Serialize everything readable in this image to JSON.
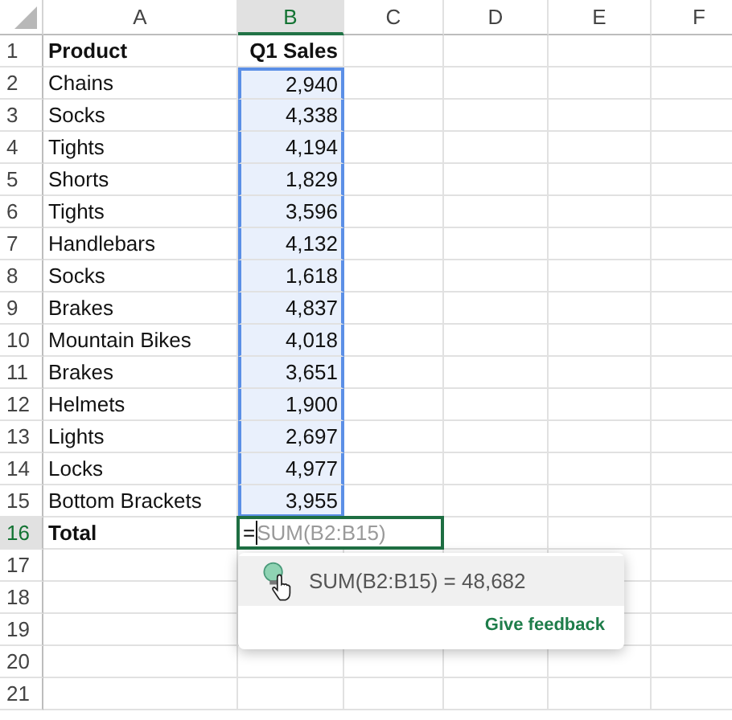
{
  "columns": [
    {
      "label": "A",
      "selected": false
    },
    {
      "label": "B",
      "selected": true
    },
    {
      "label": "C",
      "selected": false
    },
    {
      "label": "D",
      "selected": false
    },
    {
      "label": "E",
      "selected": false
    },
    {
      "label": "F",
      "selected": false
    }
  ],
  "rows": [
    {
      "number": "1",
      "kind": "header",
      "selected": false,
      "product": "Product",
      "sales": "Q1 Sales",
      "highlighted": false
    },
    {
      "number": "2",
      "kind": "data",
      "selected": false,
      "product": "Chains",
      "sales": "2,940",
      "highlighted": true
    },
    {
      "number": "3",
      "kind": "data",
      "selected": false,
      "product": "Socks",
      "sales": "4,338",
      "highlighted": true
    },
    {
      "number": "4",
      "kind": "data",
      "selected": false,
      "product": "Tights",
      "sales": "4,194",
      "highlighted": true
    },
    {
      "number": "5",
      "kind": "data",
      "selected": false,
      "product": "Shorts",
      "sales": "1,829",
      "highlighted": true
    },
    {
      "number": "6",
      "kind": "data",
      "selected": false,
      "product": "Tights",
      "sales": "3,596",
      "highlighted": true
    },
    {
      "number": "7",
      "kind": "data",
      "selected": false,
      "product": "Handlebars",
      "sales": "4,132",
      "highlighted": true
    },
    {
      "number": "8",
      "kind": "data",
      "selected": false,
      "product": "Socks",
      "sales": "1,618",
      "highlighted": true
    },
    {
      "number": "9",
      "kind": "data",
      "selected": false,
      "product": "Brakes",
      "sales": "4,837",
      "highlighted": true
    },
    {
      "number": "10",
      "kind": "data",
      "selected": false,
      "product": "Mountain Bikes",
      "sales": "4,018",
      "highlighted": true
    },
    {
      "number": "11",
      "kind": "data",
      "selected": false,
      "product": "Brakes",
      "sales": "3,651",
      "highlighted": true
    },
    {
      "number": "12",
      "kind": "data",
      "selected": false,
      "product": "Helmets",
      "sales": "1,900",
      "highlighted": true
    },
    {
      "number": "13",
      "kind": "data",
      "selected": false,
      "product": "Lights",
      "sales": "2,697",
      "highlighted": true
    },
    {
      "number": "14",
      "kind": "data",
      "selected": false,
      "product": "Locks",
      "sales": "4,977",
      "highlighted": true
    },
    {
      "number": "15",
      "kind": "data",
      "selected": false,
      "product": "Bottom Brackets",
      "sales": "3,955",
      "highlighted": true
    },
    {
      "number": "16",
      "kind": "total",
      "selected": true,
      "product": "Total",
      "typed": "=",
      "ghost": "SUM(B2:B15)"
    },
    {
      "number": "17",
      "kind": "empty",
      "selected": false
    },
    {
      "number": "18",
      "kind": "empty",
      "selected": false
    },
    {
      "number": "19",
      "kind": "empty",
      "selected": false
    },
    {
      "number": "20",
      "kind": "empty",
      "selected": false
    },
    {
      "number": "21",
      "kind": "empty",
      "selected": false
    }
  ],
  "suggestion": {
    "text": "SUM(B2:B15)  =  48,682",
    "feedback": "Give feedback"
  }
}
